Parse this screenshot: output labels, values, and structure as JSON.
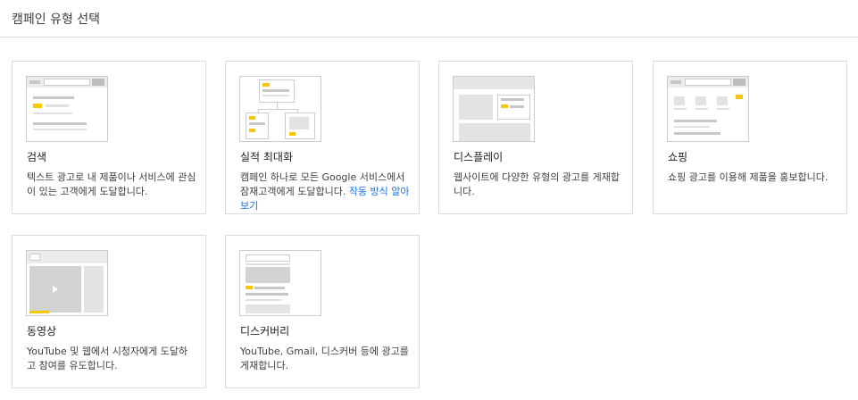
{
  "header": {
    "title": "캠페인 유형 선택"
  },
  "cards": [
    {
      "id": "search",
      "icon": "search-campaign-illustration",
      "title": "검색",
      "desc": "텍스트 광고로 내 제품이나 서비스에 관심이 있는 고객에게 도달합니다."
    },
    {
      "id": "performance-max",
      "icon": "performance-max-illustration",
      "title": "실적 최대화",
      "desc": "캠페인 하나로 모든 Google 서비스에서 잠재고객에게 도달합니다.",
      "link": "작동 방식 알아보기"
    },
    {
      "id": "display",
      "icon": "display-campaign-illustration",
      "title": "디스플레이",
      "desc": "웹사이트에 다양한 유형의 광고를 게재합니다."
    },
    {
      "id": "shopping",
      "icon": "shopping-campaign-illustration",
      "title": "쇼핑",
      "desc": "쇼핑 광고를 이용해 제품을 홍보합니다."
    },
    {
      "id": "video",
      "icon": "video-campaign-illustration",
      "title": "동영상",
      "desc": "YouTube 및 웹에서 시청자에게 도달하고 참여를 유도합니다."
    },
    {
      "id": "discovery",
      "icon": "discovery-campaign-illustration",
      "title": "디스커버리",
      "desc": "YouTube, Gmail, 디스커버 등에 광고를 게재합니다."
    }
  ],
  "colors": {
    "accent": "#f9c700",
    "border": "#dadce0",
    "link": "#1a73e8"
  }
}
